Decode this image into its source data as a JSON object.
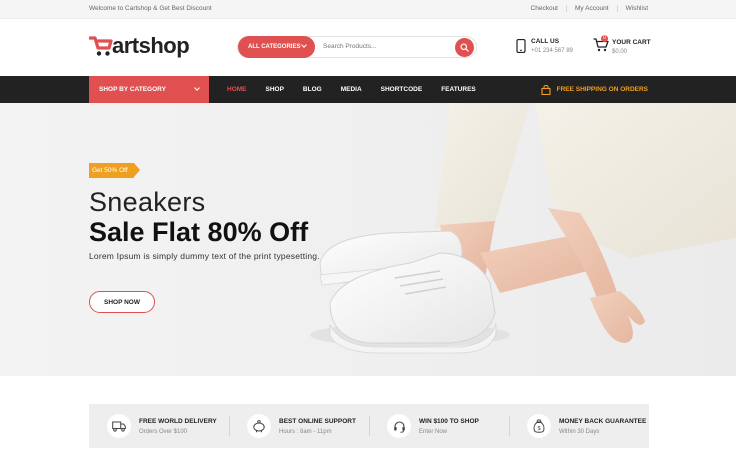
{
  "topbar": {
    "welcome": "Welcome to Cartshop & Get Best Discount",
    "links": [
      "Checkout",
      "My Account",
      "Wishlist"
    ]
  },
  "logo": {
    "text": "artshop"
  },
  "search": {
    "category_label": "ALL CATEGORIES",
    "placeholder": "Search Products...",
    "icon": "search-icon"
  },
  "contact": {
    "title": "CALL US",
    "phone": "+01 234 567 89"
  },
  "cart": {
    "title": "YOUR CART",
    "amount": "$0.00",
    "count": "0"
  },
  "nav": {
    "shop_by_category": "SHOP BY CATEGORY",
    "items": [
      {
        "label": "HOME",
        "active": true
      },
      {
        "label": "SHOP",
        "active": false
      },
      {
        "label": "BLOG",
        "active": false
      },
      {
        "label": "MEDIA",
        "active": false
      },
      {
        "label": "SHORTCODE",
        "active": false
      },
      {
        "label": "FEATURES",
        "active": false
      }
    ],
    "shipping_label": "FREE SHIPPING ON ORDERS"
  },
  "hero": {
    "badge": "Get 50% Off",
    "title_line1": "Sneakers",
    "title_line2": "Sale Flat 80% Off",
    "subtitle": "Lorem Ipsum is simply dummy text of the print typesetting.",
    "cta": "SHOP NOW"
  },
  "features": [
    {
      "title": "FREE WORLD DELIVERY",
      "subtitle": "Orders Over $100",
      "icon": "truck-icon"
    },
    {
      "title": "BEST ONLINE SUPPORT",
      "subtitle": "Hours : 8am - 11pm",
      "icon": "piggy-bank-icon"
    },
    {
      "title": "WIN $100 TO SHOP",
      "subtitle": "Enter Now",
      "icon": "headset-icon"
    },
    {
      "title": "MONEY BACK GUARANTEE",
      "subtitle": "Within 30 Days",
      "icon": "money-bag-icon"
    }
  ],
  "colors": {
    "accent": "#e05050",
    "nav_bg": "#222222",
    "shipping": "#f0a020"
  }
}
